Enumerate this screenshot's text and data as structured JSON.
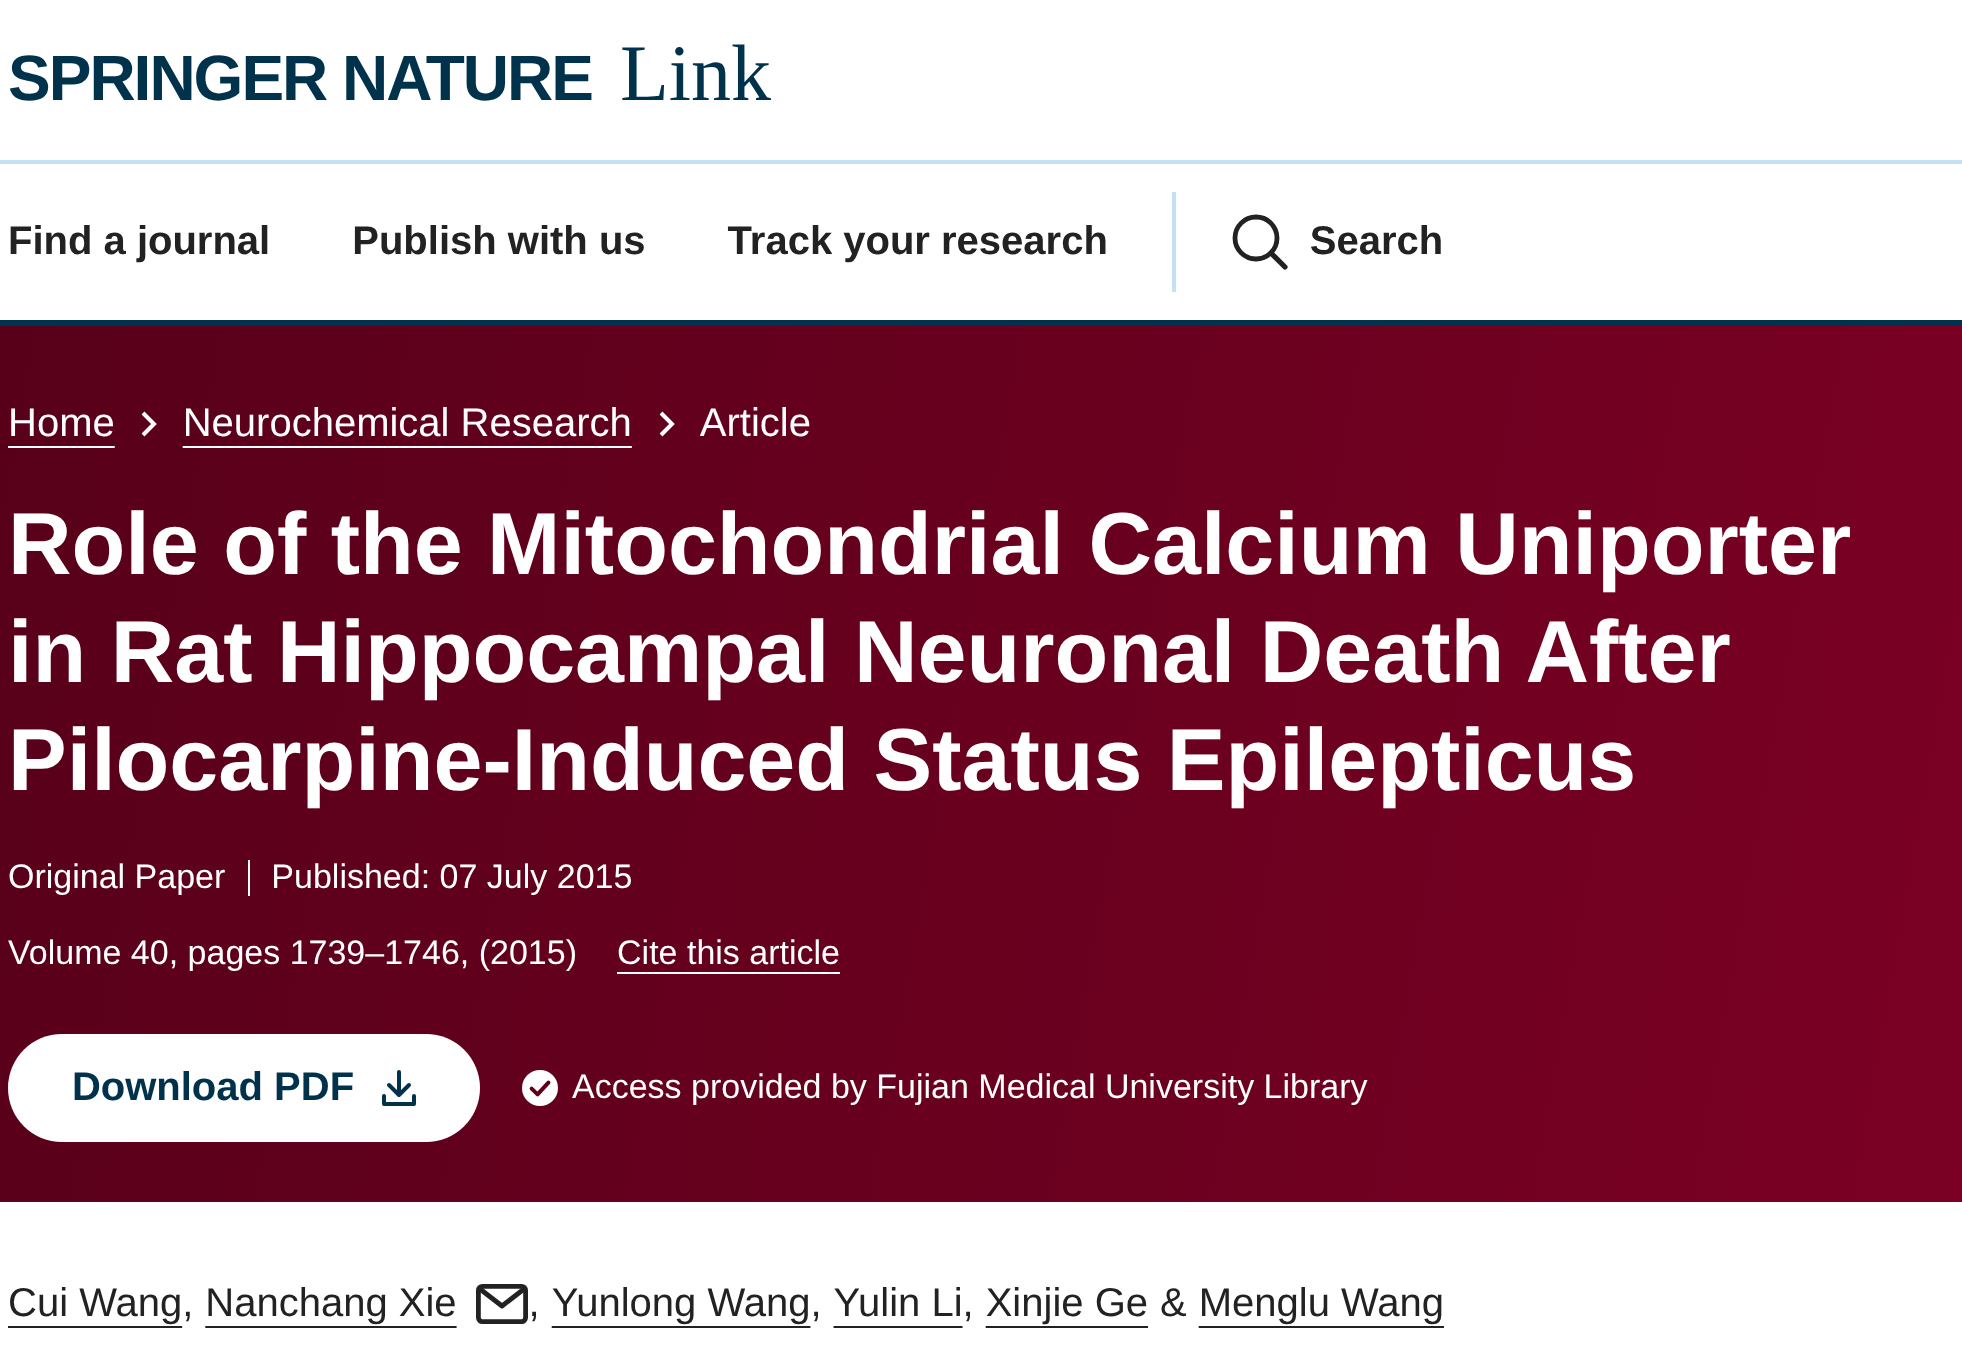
{
  "logo": {
    "brand": "SPRINGER NATURE",
    "product": "Link"
  },
  "nav": {
    "links": [
      {
        "label": "Find a journal"
      },
      {
        "label": "Publish with us"
      },
      {
        "label": "Track your research"
      }
    ],
    "search": {
      "label": "Search"
    }
  },
  "breadcrumb": [
    {
      "label": "Home",
      "kind": "link"
    },
    {
      "label": "Neurochemical Research",
      "kind": "link"
    },
    {
      "label": "Article",
      "kind": "current"
    }
  ],
  "article": {
    "title": "Role of the Mitochondrial Calcium Uniporter in Rat Hippocampal Neuronal Death After Pilocarpine-Induced Status Epilepticus",
    "type": "Original Paper",
    "published": "Published: 07 July 2015",
    "citation": "Volume 40, pages 1739–1746, (2015)",
    "cite_link": "Cite this article",
    "download_button": "Download PDF",
    "access": "Access provided by Fujian Medical University Library"
  },
  "authors": [
    {
      "name": "Cui Wang",
      "corresponding": false,
      "suffix": ","
    },
    {
      "name": "Nanchang Xie",
      "corresponding": true,
      "suffix": ","
    },
    {
      "name": "Yunlong Wang",
      "corresponding": false,
      "suffix": ","
    },
    {
      "name": "Yulin Li",
      "corresponding": false,
      "suffix": ","
    },
    {
      "name": "Xinjie Ge",
      "corresponding": false
    },
    {
      "name": "Menglu Wang",
      "corresponding": false,
      "prefix": "&"
    }
  ]
}
